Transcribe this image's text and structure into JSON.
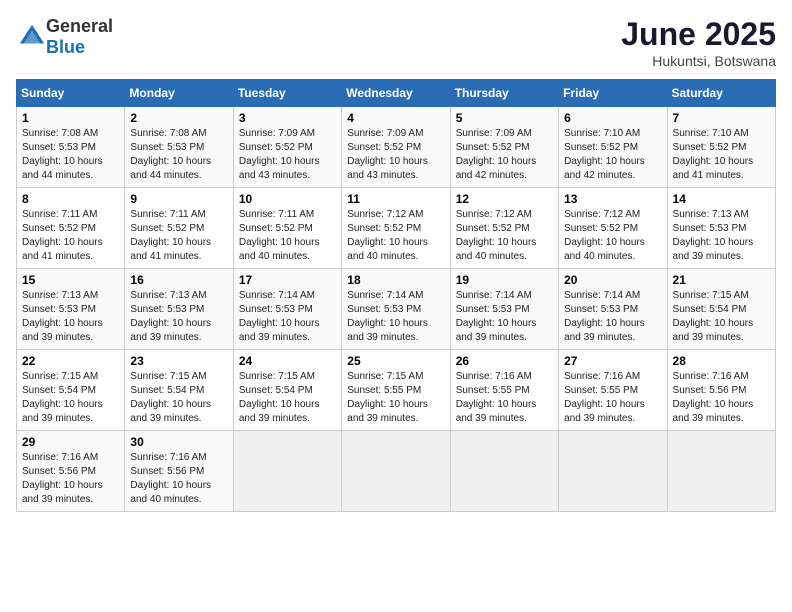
{
  "logo": {
    "general": "General",
    "blue": "Blue"
  },
  "title": "June 2025",
  "location": "Hukuntsi, Botswana",
  "headers": [
    "Sunday",
    "Monday",
    "Tuesday",
    "Wednesday",
    "Thursday",
    "Friday",
    "Saturday"
  ],
  "weeks": [
    [
      {
        "day": "1",
        "info": "Sunrise: 7:08 AM\nSunset: 5:53 PM\nDaylight: 10 hours\nand 44 minutes."
      },
      {
        "day": "2",
        "info": "Sunrise: 7:08 AM\nSunset: 5:53 PM\nDaylight: 10 hours\nand 44 minutes."
      },
      {
        "day": "3",
        "info": "Sunrise: 7:09 AM\nSunset: 5:52 PM\nDaylight: 10 hours\nand 43 minutes."
      },
      {
        "day": "4",
        "info": "Sunrise: 7:09 AM\nSunset: 5:52 PM\nDaylight: 10 hours\nand 43 minutes."
      },
      {
        "day": "5",
        "info": "Sunrise: 7:09 AM\nSunset: 5:52 PM\nDaylight: 10 hours\nand 42 minutes."
      },
      {
        "day": "6",
        "info": "Sunrise: 7:10 AM\nSunset: 5:52 PM\nDaylight: 10 hours\nand 42 minutes."
      },
      {
        "day": "7",
        "info": "Sunrise: 7:10 AM\nSunset: 5:52 PM\nDaylight: 10 hours\nand 41 minutes."
      }
    ],
    [
      {
        "day": "8",
        "info": "Sunrise: 7:11 AM\nSunset: 5:52 PM\nDaylight: 10 hours\nand 41 minutes."
      },
      {
        "day": "9",
        "info": "Sunrise: 7:11 AM\nSunset: 5:52 PM\nDaylight: 10 hours\nand 41 minutes."
      },
      {
        "day": "10",
        "info": "Sunrise: 7:11 AM\nSunset: 5:52 PM\nDaylight: 10 hours\nand 40 minutes."
      },
      {
        "day": "11",
        "info": "Sunrise: 7:12 AM\nSunset: 5:52 PM\nDaylight: 10 hours\nand 40 minutes."
      },
      {
        "day": "12",
        "info": "Sunrise: 7:12 AM\nSunset: 5:52 PM\nDaylight: 10 hours\nand 40 minutes."
      },
      {
        "day": "13",
        "info": "Sunrise: 7:12 AM\nSunset: 5:52 PM\nDaylight: 10 hours\nand 40 minutes."
      },
      {
        "day": "14",
        "info": "Sunrise: 7:13 AM\nSunset: 5:53 PM\nDaylight: 10 hours\nand 39 minutes."
      }
    ],
    [
      {
        "day": "15",
        "info": "Sunrise: 7:13 AM\nSunset: 5:53 PM\nDaylight: 10 hours\nand 39 minutes."
      },
      {
        "day": "16",
        "info": "Sunrise: 7:13 AM\nSunset: 5:53 PM\nDaylight: 10 hours\nand 39 minutes."
      },
      {
        "day": "17",
        "info": "Sunrise: 7:14 AM\nSunset: 5:53 PM\nDaylight: 10 hours\nand 39 minutes."
      },
      {
        "day": "18",
        "info": "Sunrise: 7:14 AM\nSunset: 5:53 PM\nDaylight: 10 hours\nand 39 minutes."
      },
      {
        "day": "19",
        "info": "Sunrise: 7:14 AM\nSunset: 5:53 PM\nDaylight: 10 hours\nand 39 minutes."
      },
      {
        "day": "20",
        "info": "Sunrise: 7:14 AM\nSunset: 5:53 PM\nDaylight: 10 hours\nand 39 minutes."
      },
      {
        "day": "21",
        "info": "Sunrise: 7:15 AM\nSunset: 5:54 PM\nDaylight: 10 hours\nand 39 minutes."
      }
    ],
    [
      {
        "day": "22",
        "info": "Sunrise: 7:15 AM\nSunset: 5:54 PM\nDaylight: 10 hours\nand 39 minutes."
      },
      {
        "day": "23",
        "info": "Sunrise: 7:15 AM\nSunset: 5:54 PM\nDaylight: 10 hours\nand 39 minutes."
      },
      {
        "day": "24",
        "info": "Sunrise: 7:15 AM\nSunset: 5:54 PM\nDaylight: 10 hours\nand 39 minutes."
      },
      {
        "day": "25",
        "info": "Sunrise: 7:15 AM\nSunset: 5:55 PM\nDaylight: 10 hours\nand 39 minutes."
      },
      {
        "day": "26",
        "info": "Sunrise: 7:16 AM\nSunset: 5:55 PM\nDaylight: 10 hours\nand 39 minutes."
      },
      {
        "day": "27",
        "info": "Sunrise: 7:16 AM\nSunset: 5:55 PM\nDaylight: 10 hours\nand 39 minutes."
      },
      {
        "day": "28",
        "info": "Sunrise: 7:16 AM\nSunset: 5:56 PM\nDaylight: 10 hours\nand 39 minutes."
      }
    ],
    [
      {
        "day": "29",
        "info": "Sunrise: 7:16 AM\nSunset: 5:56 PM\nDaylight: 10 hours\nand 39 minutes."
      },
      {
        "day": "30",
        "info": "Sunrise: 7:16 AM\nSunset: 5:56 PM\nDaylight: 10 hours\nand 40 minutes."
      },
      {
        "day": "",
        "info": ""
      },
      {
        "day": "",
        "info": ""
      },
      {
        "day": "",
        "info": ""
      },
      {
        "day": "",
        "info": ""
      },
      {
        "day": "",
        "info": ""
      }
    ]
  ]
}
